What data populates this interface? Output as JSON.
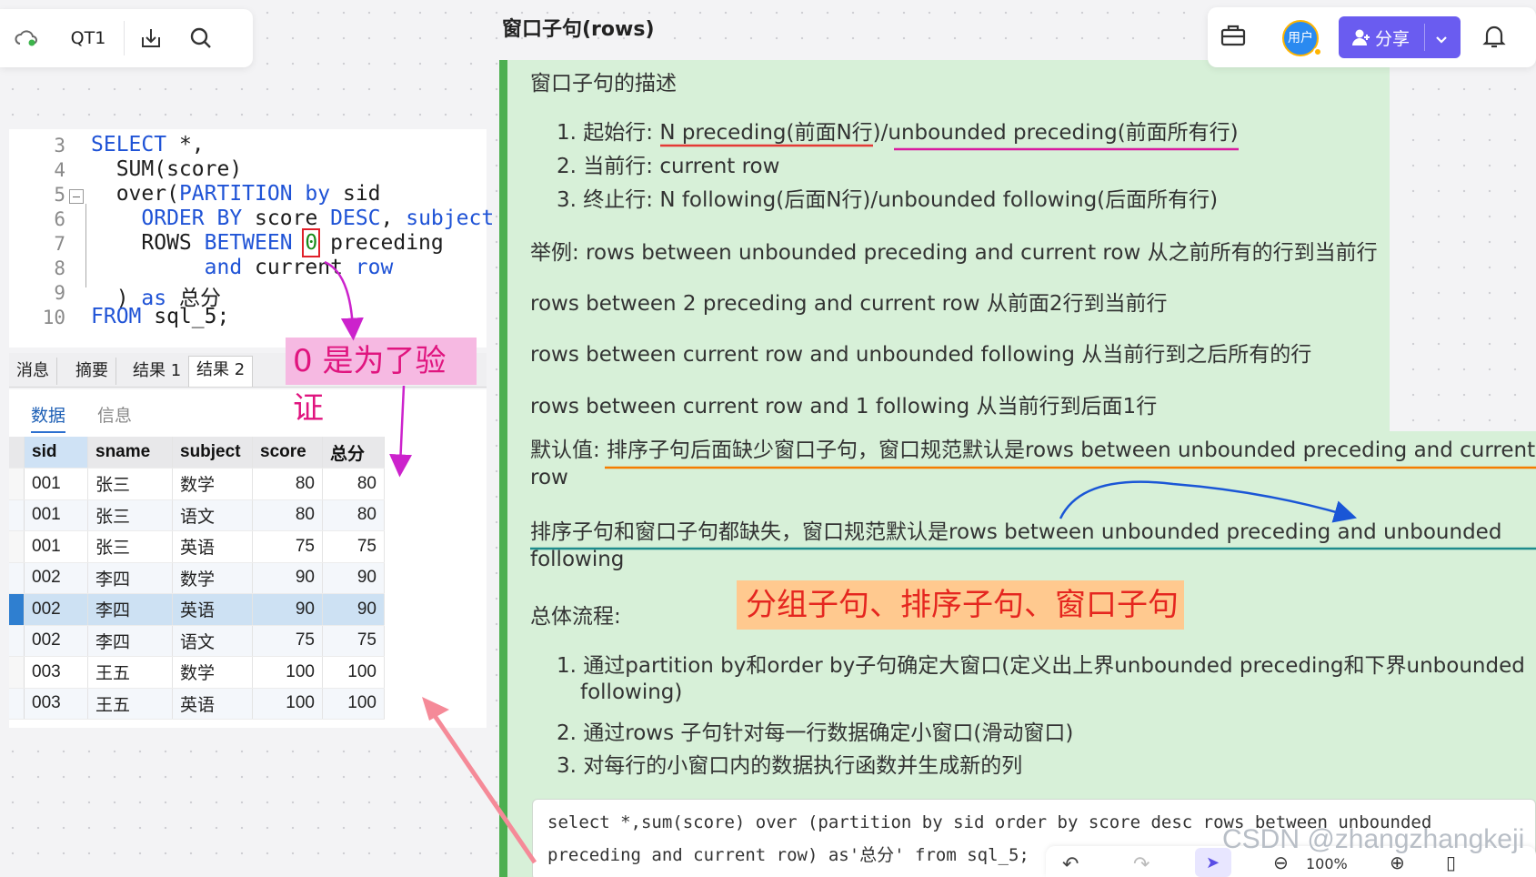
{
  "toolbar": {
    "doc_name": "QT1",
    "icons": [
      "cloud-sync-icon",
      "download-icon",
      "search-icon"
    ]
  },
  "editor": {
    "lines": [
      {
        "n": "3",
        "text": "SELECT *,"
      },
      {
        "n": "4",
        "text": "  SUM(score)"
      },
      {
        "n": "5",
        "text": "  over(PARTITION by sid"
      },
      {
        "n": "6",
        "text": "    ORDER BY score DESC, subject"
      },
      {
        "n": "7",
        "text": "    ROWS BETWEEN 0 preceding"
      },
      {
        "n": "8",
        "text": "         and current row"
      },
      {
        "n": "9",
        "text": "  ) as 总分"
      },
      {
        "n": "10",
        "text": "FROM sql_5;"
      }
    ]
  },
  "result_tabs": [
    "消息",
    "摘要",
    "结果 1",
    "结果 2"
  ],
  "sub_tabs": [
    "数据",
    "信息"
  ],
  "grid": {
    "columns": [
      "sid",
      "sname",
      "subject",
      "score",
      "总分"
    ],
    "rows": [
      [
        "001",
        "张三",
        "数学",
        "80",
        "80"
      ],
      [
        "001",
        "张三",
        "语文",
        "80",
        "80"
      ],
      [
        "001",
        "张三",
        "英语",
        "75",
        "75"
      ],
      [
        "002",
        "李四",
        "数学",
        "90",
        "90"
      ],
      [
        "002",
        "李四",
        "英语",
        "90",
        "90"
      ],
      [
        "002",
        "李四",
        "语文",
        "75",
        "75"
      ],
      [
        "003",
        "王五",
        "数学",
        "100",
        "100"
      ],
      [
        "003",
        "王五",
        "英语",
        "100",
        "100"
      ]
    ],
    "selected_row": 4
  },
  "annotations": {
    "zero_note": "0 是为了验证",
    "flow_note": "分组子句、排序子句、窗口子句"
  },
  "doc": {
    "title": "窗口子句(rows)",
    "desc_heading": "窗口子句的描述",
    "list1": [
      "1. 起始行: N preceding(前面N行)/unbounded preceding(前面所有行)",
      "2. 当前行: current row",
      "3. 终止行: N following(后面N行)/unbounded following(后面所有行)"
    ],
    "ex1": "举例: rows between unbounded preceding and current row 从之前所有的行到当前行",
    "ex2": "rows between 2 preceding and current row 从前面2行到当前行",
    "ex3": "rows between current row and unbounded following 从当前行到之后所有的行",
    "ex4": "rows between current row and 1 following 从当前行到后面1行",
    "default1a": "默认值: 排序子句后面缺少窗口子句，窗口规范默认是rows between unbounded preceding and current",
    "default1b": "row",
    "default2a": "排序子句和窗口子句都缺失，窗口规范默认是rows between unbounded preceding and unbounded",
    "default2b": "following",
    "flow_heading": "总体流程:",
    "list2": [
      "1. 通过partition by和order by子句确定大窗口(定义出上界unbounded preceding和下界unbounded",
      "following)",
      "2. 通过rows 子句针对每一行数据确定小窗口(滑动窗口)",
      "3. 对每行的小窗口内的数据执行函数并生成新的列"
    ],
    "sql_line1": "select *,sum(score) over (partition by sid order by score desc rows between unbounded",
    "sql_line2": "preceding and current row) as'总分' from sql_5;"
  },
  "header": {
    "avatar_label": "用户",
    "share_label": "分享"
  },
  "watermark": "CSDN @zhangzhangkeji",
  "bottom": {
    "zoom": "100%"
  }
}
